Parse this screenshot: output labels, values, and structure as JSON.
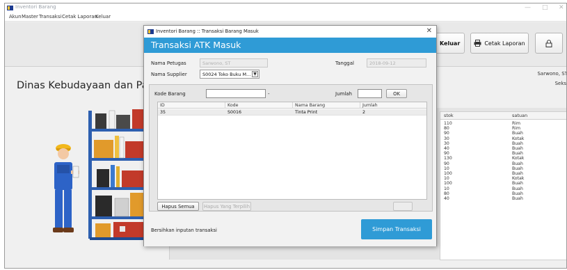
{
  "main": {
    "title": "Inventori Barang",
    "menu": [
      "Akun",
      "Master",
      "Transaksi",
      "Cetak Laporan",
      "Keluar"
    ],
    "toolbar": {
      "keluar_label": "Keluar",
      "cetak_label": "Cetak Laporan"
    },
    "agency_title": "Dinas Kebudayaan dan Pariwisata",
    "user": {
      "name": "Sarwono, ST",
      "seksi": "Seksi"
    },
    "stock_table": {
      "columns": [
        "stok",
        "satuan"
      ],
      "rows": [
        [
          "110",
          "Rim"
        ],
        [
          "80",
          "Rim"
        ],
        [
          "90",
          "Buah"
        ],
        [
          "30",
          "Kotak"
        ],
        [
          "30",
          "Buah"
        ],
        [
          "40",
          "Buah"
        ],
        [
          "90",
          "Buah"
        ],
        [
          "130",
          "Kotak"
        ],
        [
          "90",
          "Buah"
        ],
        [
          "10",
          "Buah"
        ],
        [
          "100",
          "Buah"
        ],
        [
          "10",
          "Kotak"
        ],
        [
          "100",
          "Buah"
        ],
        [
          "10",
          "Buah"
        ],
        [
          "80",
          "Buah"
        ],
        [
          "40",
          "Buah"
        ]
      ]
    }
  },
  "dialog": {
    "title": "Inventori Barang :: Transaksi Barang Masuk",
    "banner": "Transaksi ATK Masuk",
    "petugas_label": "Nama Petugas",
    "petugas_value": "Sarwono, ST",
    "tanggal_label": "Tanggal",
    "tanggal_value": "2018-09-12",
    "supplier_label": "Nama Supplier",
    "supplier_value": "S0024 Toko Buku M...",
    "kode_label": "Kode Barang",
    "dash": "-",
    "jumlah_label": "Jumlah",
    "ok_label": "OK",
    "table": {
      "columns": [
        "ID",
        "Kode",
        "Nama Barang",
        "Jumlah"
      ],
      "rows": [
        [
          "35",
          "S0016",
          "Tinta Print",
          "2"
        ]
      ]
    },
    "hapus_semua_label": "Hapus Semua",
    "hapus_terpilih_label": "Hapus Yang Terpilih",
    "footer_text": "Bersihkan inputan transaksi",
    "simpan_label": "Simpan Transaksi"
  },
  "colors": {
    "accent": "#2f9bd6",
    "window_bg": "#f0f0f0"
  }
}
